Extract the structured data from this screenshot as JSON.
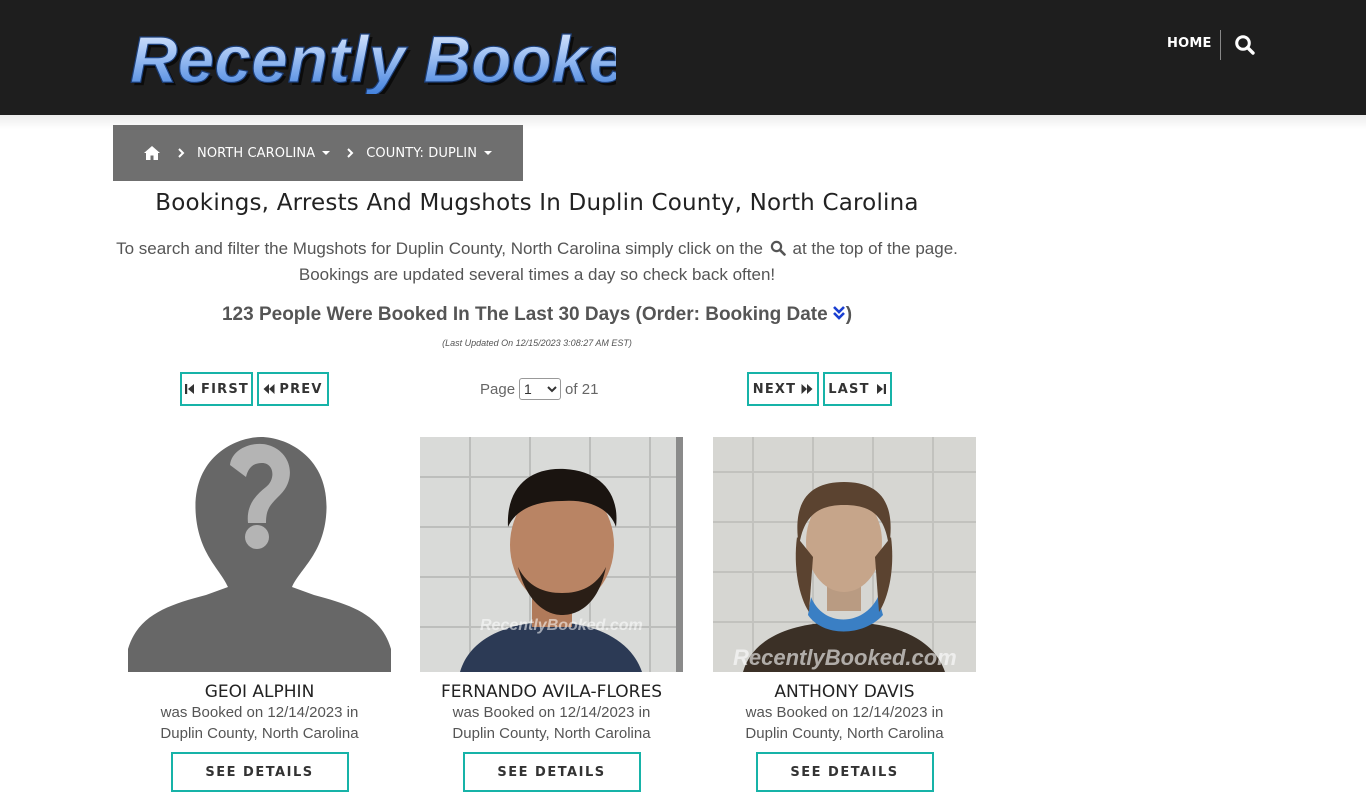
{
  "header": {
    "logo_text": "Recently Booked",
    "nav_home": "HOME",
    "search_icon": "search-icon"
  },
  "breadcrumb": {
    "home_icon": "home-icon",
    "state": "NORTH CAROLINA",
    "county": "COUNTY: DUPLIN"
  },
  "main": {
    "title": "Bookings, Arrests And Mugshots In Duplin County, North Carolina",
    "intro_part1": "To search and filter the Mugshots for Duplin County, North Carolina simply click on the",
    "intro_part2": "at the top of the page.",
    "intro_line2": "Bookings are updated several times a day so check back often!",
    "count_text": "123 People Were Booked In The Last 30 Days (Order: Booking Date",
    "count_close": ")",
    "last_updated": "(Last Updated On 12/15/2023 3:08:27 AM EST)"
  },
  "pagination": {
    "first": "FIRST",
    "prev": "PREV",
    "next": "NEXT",
    "last": "LAST",
    "page_label": "Page",
    "current_page": "1",
    "of_label": "of 21"
  },
  "colors": {
    "header_bg": "#1e1e1e",
    "breadcrumb_bg": "#6f6f6f",
    "accent_teal": "#17b3a8"
  },
  "bookings": [
    {
      "name": "GEOI ALPHIN",
      "booked_line": "was Booked on 12/14/2023 in",
      "location": "Duplin County, North Carolina",
      "button": "SEE DETAILS"
    },
    {
      "name": "FERNANDO AVILA-FLORES",
      "booked_line": "was Booked on 12/14/2023 in",
      "location": "Duplin County, North Carolina",
      "button": "SEE DETAILS",
      "watermark": "RecentlyBooked.com"
    },
    {
      "name": "ANTHONY DAVIS",
      "booked_line": "was Booked on 12/14/2023 in",
      "location": "Duplin County, North Carolina",
      "button": "SEE DETAILS",
      "watermark": "RecentlyBooked.com"
    }
  ]
}
